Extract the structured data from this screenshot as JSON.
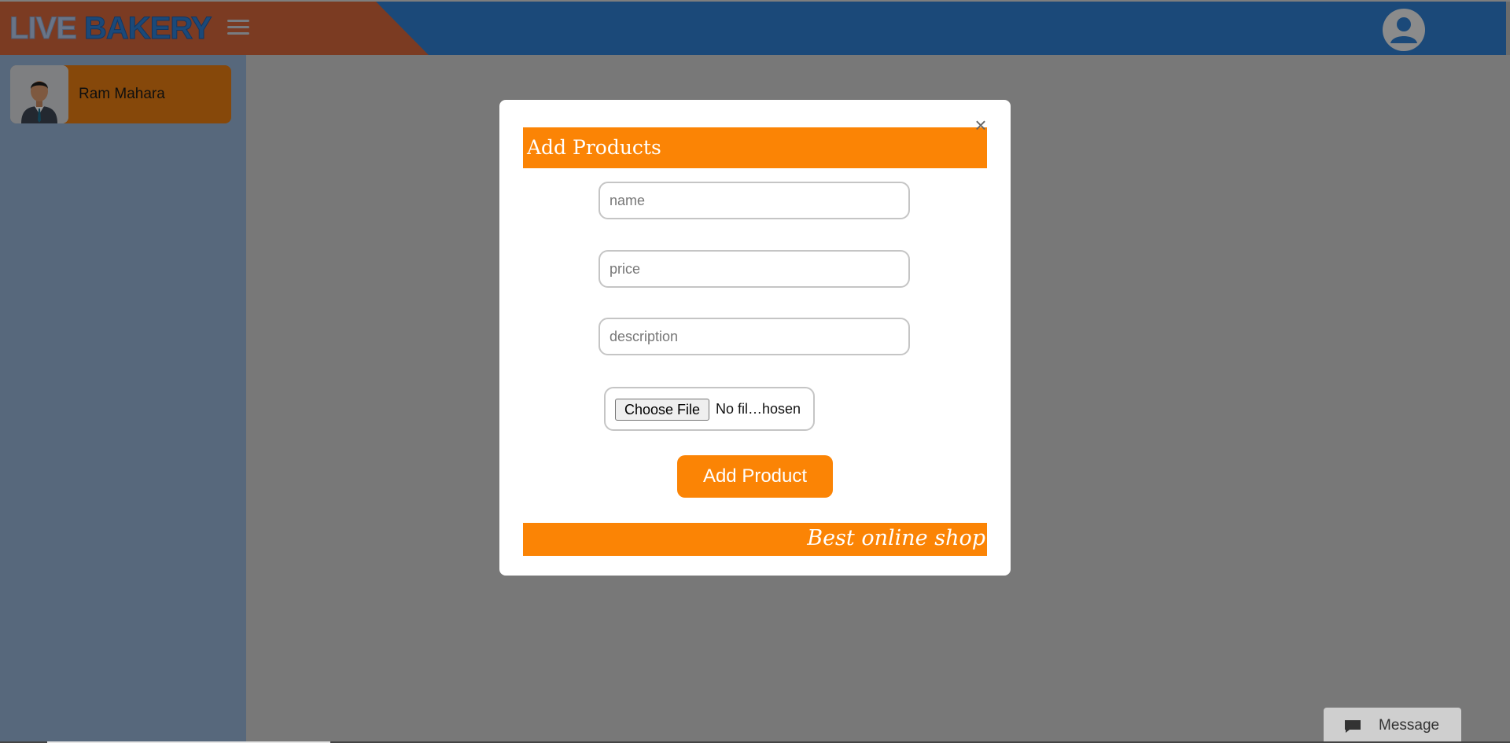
{
  "brand": {
    "part1": "LIVE",
    "part2": "BAKERY"
  },
  "header": {
    "menu_icon": "hamburger-icon",
    "user_icon": "user-circle-icon"
  },
  "sidebar": {
    "profile": {
      "name": "Ram Mahara",
      "avatar_icon": "businessman-avatar"
    }
  },
  "modal": {
    "title": "Add Products",
    "close_glyph": "×",
    "fields": {
      "name_placeholder": "name",
      "price_placeholder": "price",
      "description_placeholder": "description"
    },
    "file": {
      "button_label": "Choose File",
      "status": "No fil…hosen"
    },
    "submit_label": "Add Product",
    "footer_text": "Best online shop"
  },
  "message": {
    "label": "Message",
    "icon": "chat-bubble-icon"
  },
  "colors": {
    "header_blue": "#2f7fd1",
    "brand_red": "#d5663b",
    "accent_orange": "#fb8405",
    "sidebar_blue": "#96b4d6"
  }
}
